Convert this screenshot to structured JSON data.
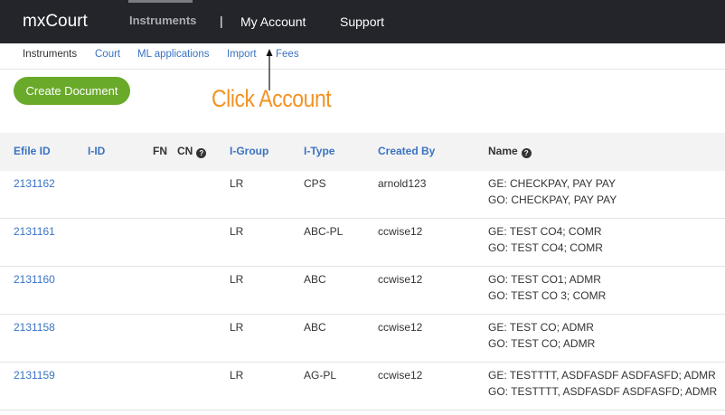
{
  "topbar": {
    "brand": "mxCourt",
    "nav": [
      {
        "label": "Instruments",
        "active": true
      },
      {
        "label": "|"
      },
      {
        "label": "My Account"
      },
      {
        "label": "Support"
      }
    ]
  },
  "subnav": [
    "Instruments",
    "Court",
    "ML applications",
    "Import",
    "Fees"
  ],
  "create_button": "Create Document",
  "annotation": "Click Account",
  "table": {
    "columns": [
      "Efile ID",
      "I-ID",
      "FN",
      "CN",
      "I-Group",
      "I-Type",
      "Created By",
      "Name"
    ],
    "rows": [
      {
        "efile_id": "2131162",
        "i_group": "LR",
        "i_type": "CPS",
        "created_by": "arnold123",
        "name_1": "GE: CHECKPAY, PAY PAY",
        "name_2": "GO: CHECKPAY, PAY PAY"
      },
      {
        "efile_id": "2131161",
        "i_group": "LR",
        "i_type": "ABC-PL",
        "created_by": "ccwise12",
        "name_1": "GE: TEST CO4; COMR",
        "name_2": "GO: TEST CO4; COMR"
      },
      {
        "efile_id": "2131160",
        "i_group": "LR",
        "i_type": "ABC",
        "created_by": "ccwise12",
        "name_1": "GO: TEST CO1; ADMR",
        "name_2": "GO: TEST CO 3; COMR"
      },
      {
        "efile_id": "2131158",
        "i_group": "LR",
        "i_type": "ABC",
        "created_by": "ccwise12",
        "name_1": "GE: TEST CO; ADMR",
        "name_2": "GO: TEST CO; ADMR"
      },
      {
        "efile_id": "2131159",
        "i_group": "LR",
        "i_type": "AG-PL",
        "created_by": "ccwise12",
        "name_1": "GE: TESTTTT, ASDFASDF ASDFASFD; ADMR",
        "name_2": "GO: TESTTTT, ASDFASDF ASDFASFD; ADMR"
      }
    ]
  },
  "colors": {
    "topbar": "#23252b",
    "link": "#3a73c2",
    "button": "#6aaa2a",
    "annotation": "#f39224"
  }
}
